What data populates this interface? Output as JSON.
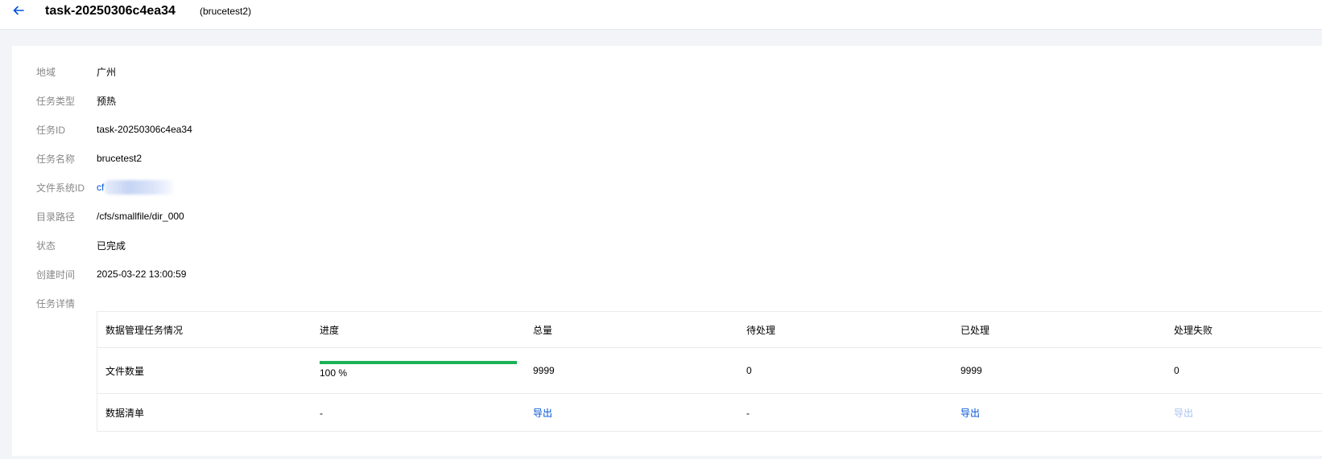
{
  "header": {
    "title": "task-20250306c4ea34",
    "subtitle": "(brucetest2)"
  },
  "info": {
    "region": {
      "label": "地域",
      "value": "广州"
    },
    "task_type": {
      "label": "任务类型",
      "value": "预热"
    },
    "task_id": {
      "label": "任务ID",
      "value": "task-20250306c4ea34"
    },
    "task_name": {
      "label": "任务名称",
      "value": "brucetest2"
    },
    "fs_id": {
      "label": "文件系统ID",
      "value": "cf"
    },
    "dir_path": {
      "label": "目录路径",
      "value": "/cfs/smallfile/dir_000"
    },
    "status": {
      "label": "状态",
      "value": "已完成"
    },
    "created": {
      "label": "创建时间",
      "value": "2025-03-22 13:00:59"
    },
    "details_label": "任务详情"
  },
  "table": {
    "headers": [
      "数据管理任务情况",
      "进度",
      "总量",
      "待处理",
      "已处理",
      "处理失败"
    ],
    "file_count": {
      "label": "文件数量",
      "progress_percent": 100,
      "progress_text": "100 %",
      "total": "9999",
      "pending": "0",
      "processed": "9999",
      "failed": "0"
    },
    "data_list": {
      "label": "数据清单",
      "progress": "-",
      "total_link": "导出",
      "pending": "-",
      "processed_link": "导出",
      "failed_link": "导出"
    }
  },
  "colors": {
    "accent": "#0052d9",
    "progress": "#1ab257",
    "disabled_link": "#a8c2f2"
  }
}
